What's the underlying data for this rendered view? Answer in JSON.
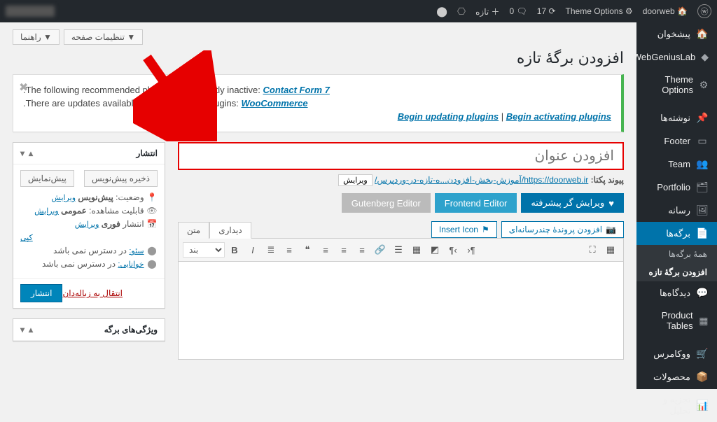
{
  "adminbar": {
    "site": "doorweb",
    "theme_options": "Theme Options",
    "updates_count": "17",
    "comments_count": "0",
    "new_label": "تازه"
  },
  "sidebar": {
    "dashboard": "پیشخوان",
    "webgenius": "WebGeniusLab",
    "theme_options": "Theme Options",
    "posts": "نوشته‌ها",
    "footer": "Footer",
    "team": "Team",
    "portfolio": "Portfolio",
    "media": "رسانه",
    "pages": "برگه‌ها",
    "all_pages": "همهٔ برگه‌ها",
    "add_new": "افزودن برگهٔ تازه",
    "comments": "دیدگاه‌ها",
    "product_tables": "Product Tables",
    "woocommerce": "ووکامرس",
    "products": "محصولات",
    "analytics": "تجزیه و تحلیل"
  },
  "screen": {
    "options": "تنظیمات صفحه ▼",
    "help": "راهنما ▼"
  },
  "page_title": "افزودن برگهٔ تازه",
  "notice": {
    "line1_pre": ".The following recommended plugins are currently inactive: ",
    "line1_link": "Contact Form 7",
    "line2_pre": ".There are updates available for the following plugins: ",
    "line2_link": "WooCommerce",
    "begin_update": "Begin updating plugins",
    "sep": " | ",
    "begin_activate": "Begin activating plugins"
  },
  "title_placeholder": "افزودن عنوان",
  "permalink": {
    "label": "پیوند پکتا:",
    "url_base": "https://doorweb.ir/",
    "url_slug": "آموزش-بخش-افزودن...ه-تازه-در-وردپرس/",
    "edit": "ویرایش"
  },
  "modes": {
    "advanced": "ویرایش گر پیشرفته",
    "frontend": "Frontend Editor",
    "gutenberg": "Gutenberg Editor"
  },
  "media": {
    "add_media": "افزودن پروندهٔ چندرسانه‌ای",
    "insert_icon": "Insert Icon"
  },
  "editor_tabs": {
    "visual": "دیداری",
    "text": "متن"
  },
  "tinymce": {
    "paragraph": "بند"
  },
  "publish_box": {
    "title": "انتشار",
    "save_draft": "ذخیره پیش‌نویس",
    "preview": "پیش‌نمایش",
    "status_label": "وضعیت:",
    "status_value": "پیش‌نویس",
    "visibility_label": "قابلیت مشاهده:",
    "visibility_value": "عمومی",
    "publish_label": "انتشار",
    "publish_value": "فوری",
    "edit": "ویرایش",
    "copy": "کپی",
    "seo_label": "سئو:",
    "seo_value": "در دسترس نمی باشد",
    "readability_label": "خوانایی:",
    "readability_value": "در دسترس نمی باشد",
    "trash": "انتقال به زباله‌دان",
    "publish_btn": "انتشار"
  },
  "page_attr": {
    "title": "ویژگی‌های برگه"
  }
}
